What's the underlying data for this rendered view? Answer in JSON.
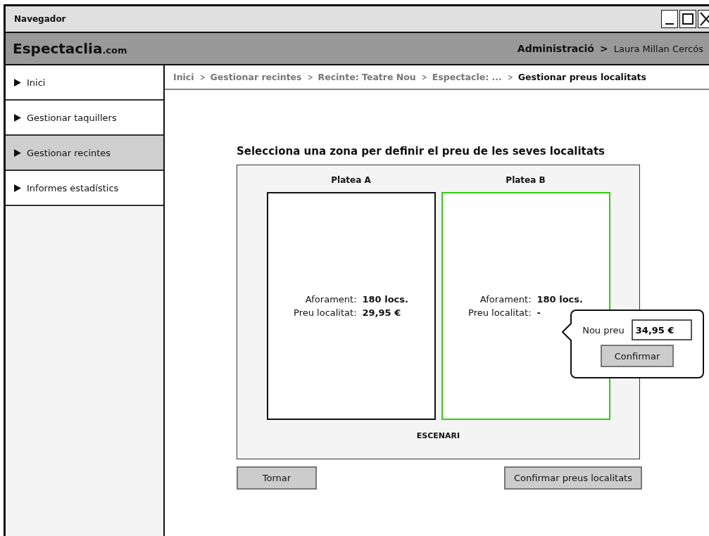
{
  "window": {
    "title": "Navegador"
  },
  "header": {
    "logo": "Espectaclia",
    "logo_suffix": ".com",
    "section": "Administració",
    "separator": ">",
    "user": "Laura Millan Cercós"
  },
  "sidebar": {
    "items": [
      {
        "label": "Inici",
        "selected": false
      },
      {
        "label": "Gestionar taquillers",
        "selected": false
      },
      {
        "label": "Gestionar recintes",
        "selected": true
      },
      {
        "label": "Informes estadístics",
        "selected": false
      }
    ]
  },
  "breadcrumb": [
    {
      "label": "Inici",
      "selected": false
    },
    {
      "label": "Gestionar recintes",
      "selected": false
    },
    {
      "label": "Recinte: Teatre Nou",
      "selected": false
    },
    {
      "label": "Espectacle: ...",
      "selected": false
    },
    {
      "label": "Gestionar preus localitats",
      "selected": true
    }
  ],
  "heading": "Selecciona una zona per definir el preu de les seves localitats",
  "zones": [
    {
      "name": "Platea A",
      "selected": false,
      "capacity_label": "Aforament:",
      "capacity": "180 locs.",
      "price_label": "Preu localitat:",
      "price": "29,95 €"
    },
    {
      "name": "Platea B",
      "selected": true,
      "capacity_label": "Aforament:",
      "capacity": "180 locs.",
      "price_label": "Preu localitat:",
      "price": "-"
    }
  ],
  "stage_label": "ESCENARI",
  "popover": {
    "label": "Nou preu",
    "value": "34,95 €",
    "button": "Confirmar"
  },
  "buttons": {
    "back": "Tornar",
    "confirm": "Confirmar preus localitats"
  }
}
